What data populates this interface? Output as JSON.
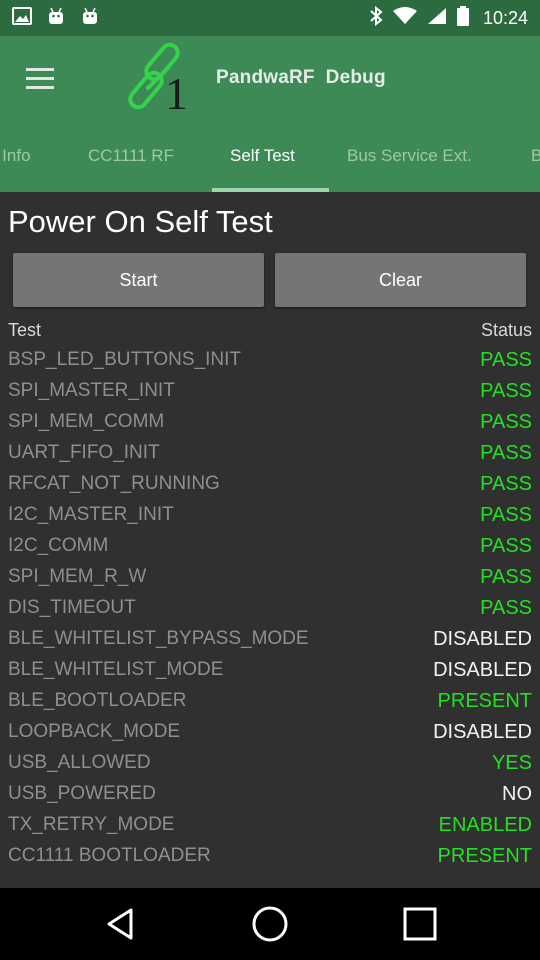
{
  "status_bar": {
    "time": "10:24",
    "left_icons": [
      "gallery-icon",
      "android-icon",
      "android-icon"
    ],
    "right_icons": [
      "bluetooth-icon",
      "wifi-icon",
      "signal-icon",
      "battery-icon"
    ]
  },
  "app_bar": {
    "title": "PandwaRF  Debug",
    "logo_char": "1"
  },
  "tabs": [
    {
      "label": "p Info"
    },
    {
      "label": "CC1111 RF"
    },
    {
      "label": "Self Test"
    },
    {
      "label": "Bus Service Ext."
    },
    {
      "label": "B"
    }
  ],
  "active_tab": "Self Test",
  "page": {
    "title": "Power On Self Test",
    "start_label": "Start",
    "clear_label": "Clear",
    "col_test": "Test",
    "col_status": "Status"
  },
  "colors": {
    "status_bar": "#2b6b3f",
    "app_bar": "#3d8a56",
    "pass": "#22e022",
    "neutral": "#f2f2f2",
    "background": "#303030"
  },
  "results": [
    {
      "name": "BSP_LED_BUTTONS_INIT",
      "value": "PASS",
      "color": "#22e022"
    },
    {
      "name": "SPI_MASTER_INIT",
      "value": "PASS",
      "color": "#22e022"
    },
    {
      "name": "SPI_MEM_COMM",
      "value": "PASS",
      "color": "#22e022"
    },
    {
      "name": "UART_FIFO_INIT",
      "value": "PASS",
      "color": "#22e022"
    },
    {
      "name": "RFCAT_NOT_RUNNING",
      "value": "PASS",
      "color": "#22e022"
    },
    {
      "name": "I2C_MASTER_INIT",
      "value": "PASS",
      "color": "#22e022"
    },
    {
      "name": "I2C_COMM",
      "value": "PASS",
      "color": "#22e022"
    },
    {
      "name": "SPI_MEM_R_W",
      "value": "PASS",
      "color": "#22e022"
    },
    {
      "name": "DIS_TIMEOUT",
      "value": "PASS",
      "color": "#22e022"
    },
    {
      "name": "BLE_WHITELIST_BYPASS_MODE",
      "value": "DISABLED",
      "color": "#f2f2f2"
    },
    {
      "name": "BLE_WHITELIST_MODE",
      "value": "DISABLED",
      "color": "#f2f2f2"
    },
    {
      "name": "BLE_BOOTLOADER",
      "value": "PRESENT",
      "color": "#22e022"
    },
    {
      "name": "LOOPBACK_MODE",
      "value": "DISABLED",
      "color": "#f2f2f2"
    },
    {
      "name": "USB_ALLOWED",
      "value": "YES",
      "color": "#22e022"
    },
    {
      "name": "USB_POWERED",
      "value": "NO",
      "color": "#f2f2f2"
    },
    {
      "name": "TX_RETRY_MODE",
      "value": "ENABLED",
      "color": "#22e022"
    },
    {
      "name": "CC1111 BOOTLOADER",
      "value": "PRESENT",
      "color": "#22e022"
    }
  ],
  "nav_bar": {
    "icons": [
      "back-icon",
      "home-icon",
      "recent-apps-icon"
    ]
  }
}
